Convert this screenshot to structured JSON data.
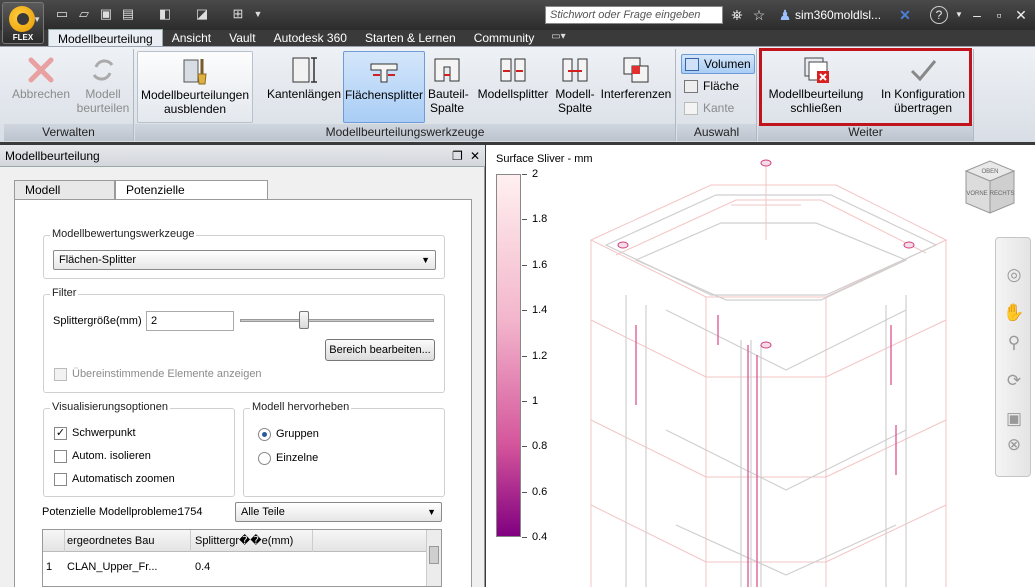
{
  "titlebar": {
    "app_badge": "FLEX",
    "search_placeholder": "Stichwort oder Frage eingeben",
    "user": "sim360moldlsl...",
    "help": "?"
  },
  "tabs": [
    "Modellbeurteilung",
    "Ansicht",
    "Vault",
    "Autodesk 360",
    "Starten & Lernen",
    "Community"
  ],
  "ribbon": {
    "verwalten": {
      "title": "Verwalten",
      "abbrechen": "Abbrechen",
      "beurteilen_1": "Modell",
      "beurteilen_2": "beurteilen"
    },
    "ausblenden_1": "Modellbeurteilungen",
    "ausblenden_2": "ausblenden",
    "werkzeuge": {
      "title": "Modellbeurteilungswerkzeuge",
      "kantenlaengen": "Kantenlängen",
      "flaechensplitter": "Flächensplitter",
      "bauteilspalte_1": "Bauteil-",
      "bauteilspalte_2": "Spalte",
      "modellsplitter": "Modellsplitter",
      "modellspalte_1": "Modell-",
      "modellspalte_2": "Spalte",
      "interferenzen": "Interferenzen"
    },
    "auswahl": {
      "title": "Auswahl",
      "volumen": "Volumen",
      "flaeche": "Fläche",
      "kante": "Kante"
    },
    "weiter": {
      "title": "Weiter",
      "schliessen_1": "Modellbeurteilung",
      "schliessen_2": "schließen",
      "uebertragen_1": "In Konfiguration",
      "uebertragen_2": "übertragen"
    }
  },
  "leftpanel": {
    "title": "Modellbeurteilung",
    "tabs": [
      "Modell bewerten",
      "Potenzielle Modellprobleme"
    ],
    "werkzeuge_group": "Modellbewertungswerkzeuge",
    "werkzeug_selected": "Flächen-Splitter",
    "filter_group": "Filter",
    "splitter_label": "Splittergröße(mm)",
    "splitter_value": "2",
    "slider_level": 0.33,
    "bereich_button": "Bereich bearbeiten...",
    "uebereinstimmend": "Übereinstimmende Elemente anzeigen",
    "vis_group": "Visualisierungsoptionen",
    "schwerpunkt": "Schwerpunkt",
    "isolieren": "Autom. isolieren",
    "zoomen": "Automatisch zoomen",
    "hervor_group": "Modell hervorheben",
    "gruppen": "Gruppen",
    "einzelne": "Einzelne",
    "probleme_label": "Potenzielle Modellprobleme:",
    "probleme_count": "1754",
    "teile_selected": "Alle Teile",
    "table_headers": [
      "ergeordnetes Bau",
      "Splittergr��e(mm)"
    ],
    "table_rows": [
      [
        "1",
        "CLAN_Upper_Fr...",
        "0.4"
      ]
    ]
  },
  "viewport": {
    "legend_title": "Surface Sliver - mm",
    "legend_ticks": [
      "2",
      "1.8",
      "1.6",
      "1.4",
      "1.2",
      "1",
      "0.8",
      "0.6",
      "0.4"
    ],
    "viewcube_labels": [
      "OBEN",
      "VORNE",
      "RECHTS"
    ]
  }
}
